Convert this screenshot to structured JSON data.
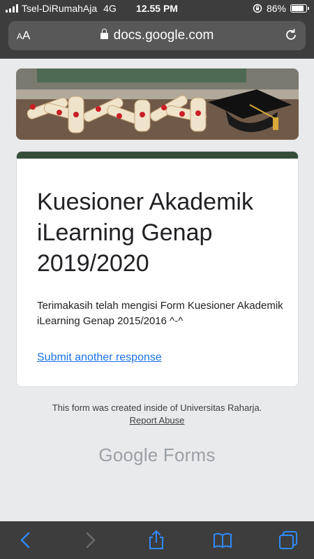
{
  "status_bar": {
    "carrier": "Tsel-DiRumahAja",
    "network": "4G",
    "time": "12.55 PM",
    "battery": "86%",
    "battery_level": 0.86
  },
  "address_bar": {
    "text_size_label": "AA",
    "url": "docs.google.com"
  },
  "form": {
    "accent_color": "#334d3a",
    "title": "Kuesioner Akademik iLearning Genap 2019/2020",
    "confirmation_message": "Terimakasih telah mengisi Form Kuesioner Akademik iLearning Genap 2015/2016 ^-^",
    "submit_another_label": "Submit another response"
  },
  "footer": {
    "created_text": "This form was created inside of Universitas Raharja.",
    "report_abuse_label": "Report Abuse",
    "brand_google": "Google",
    "brand_forms": "Forms"
  },
  "toolbar": {
    "icons": [
      "back-icon",
      "forward-icon",
      "share-icon",
      "bookmarks-icon",
      "tabs-icon"
    ]
  }
}
